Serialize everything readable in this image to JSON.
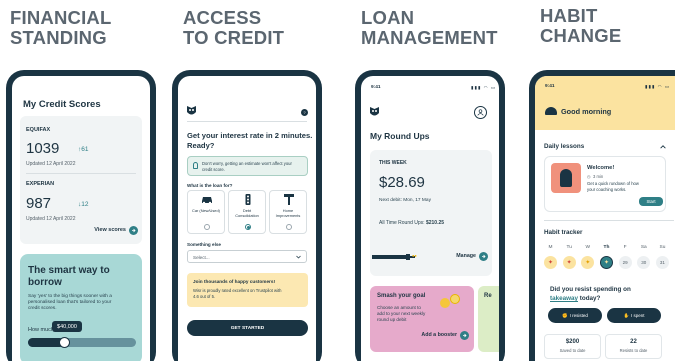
{
  "headings": {
    "financial": [
      "FINANCIAL",
      "STANDING"
    ],
    "credit": [
      "ACCESS",
      "TO CREDIT"
    ],
    "loan": [
      "LOAN",
      "MANAGEMENT"
    ],
    "habit": [
      "HABIT",
      "CHANGE"
    ]
  },
  "phone1": {
    "title": "My Credit Scores",
    "equifax": {
      "label": "EQUIFAX",
      "score": "1039",
      "change": "↑61",
      "updated": "Updated 12 April 2022"
    },
    "experian": {
      "label": "EXPERIAN",
      "score": "987",
      "change": "↓12",
      "updated": "Updated 12 April 2022"
    },
    "view_scores": "View scores",
    "promo": {
      "title_1": "The smart way to",
      "title_2": "borrow",
      "body_1": "Say 'yes' to the big things sooner with a",
      "body_2": "personalised loan that's tailored to your",
      "body_3": "credit scores.",
      "how_much": "How much?",
      "amount": "$40,000",
      "slider_level": 0.33
    }
  },
  "phone2": {
    "heading_1": "Get your interest rate in 2 minutes.",
    "heading_2": "Ready?",
    "notice_1": "Don't worry, getting an estimate won't affect your",
    "notice_2": "credit score.",
    "question": "What is the loan for?",
    "options": [
      {
        "label_1": "Car (New/Used)",
        "label_2": "",
        "icon": "car-icon"
      },
      {
        "label_1": "Debt",
        "label_2": "Consolidation",
        "icon": "traffic-light-icon"
      },
      {
        "label_1": "Home",
        "label_2": "Improvements",
        "icon": "hammer-icon"
      }
    ],
    "something_else": "Something else",
    "select_placeholder": "Select...",
    "join_title": "Join thousands of happy customers!",
    "join_body_1": "Wisr is proudly rated excellent on Trustpilot with",
    "join_body_2": "4.6 out of 5.",
    "cta": "GET STARTED"
  },
  "phone3": {
    "time": "9:41",
    "title": "My Round Ups",
    "week_label": "THIS WEEK",
    "amount": "$28.69",
    "next_debit": "Next debit: Mon, 17 May",
    "all_time_label": "All Time Round Ups:",
    "all_time_value": "$210.25",
    "manage": "Manage",
    "smash": {
      "title": "Smash your goal",
      "body_1": "Choose an amount to",
      "body_2": "add to your next weekly",
      "body_3": "round up debit",
      "cta": "Add a booster"
    },
    "peek": "Re"
  },
  "phone4": {
    "time": "9:41",
    "greeting": "Good morning",
    "daily_lessons": "Daily lessons",
    "lesson": {
      "title": "Welcome!",
      "duration": "3 min",
      "body_1": "Get a quick rundown of how",
      "body_2": "your coaching works.",
      "cta": "Start"
    },
    "habit_tracker": "Habit tracker",
    "days": [
      "M",
      "Tu",
      "W",
      "Th",
      "F",
      "Sa",
      "Su"
    ],
    "dates": [
      "",
      "",
      "",
      "",
      "29",
      "30",
      "31"
    ],
    "question_1": "Did you resist spending on",
    "question_highlight": "takeaway",
    "question_2": "today?",
    "resisted": "I resisted",
    "spent": "I spent",
    "stats": [
      {
        "value": "$200",
        "label": "Saved to date"
      },
      {
        "value": "22",
        "label": "Resists to date"
      }
    ]
  }
}
